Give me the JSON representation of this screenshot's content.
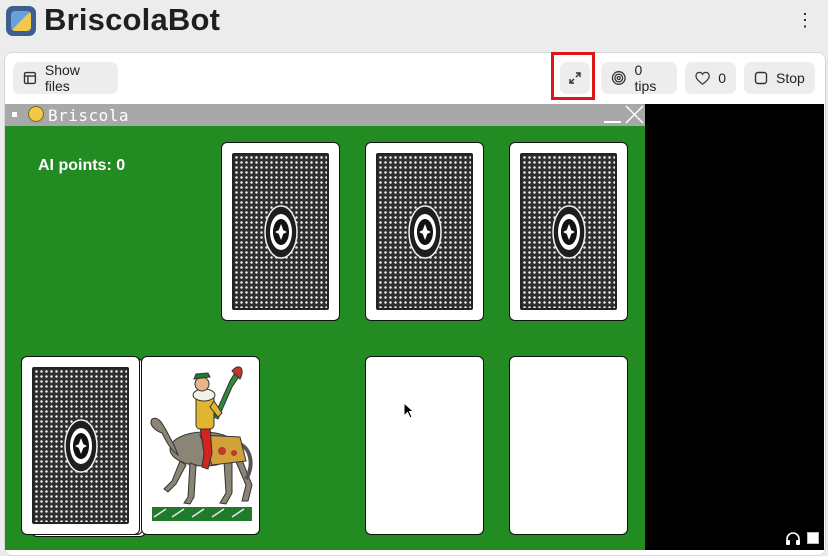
{
  "app": {
    "title": "BriscolaBot",
    "menu_icon": "kebab-menu-icon"
  },
  "toolbar": {
    "show_files_label": "Show files",
    "show_files_icon": "files-icon",
    "expand_icon": "expand-icon",
    "tips_label": "0 tips",
    "tips_icon": "spiral-icon",
    "likes_count": "0",
    "likes_icon": "heart-icon",
    "stop_label": "Stop",
    "stop_icon": "stop-square-icon",
    "highlight_color": "#e0141b"
  },
  "game": {
    "window_title": "Briscola",
    "background_color": "#228b22",
    "ai_points_label": "AI points: 0",
    "opponent_hand": [
      {
        "face": "back"
      },
      {
        "face": "back"
      },
      {
        "face": "back"
      }
    ],
    "deck": {
      "face": "back"
    },
    "briscola_card": {
      "face": "horse-rider",
      "suit_icon": "cavallo-card-illustration"
    },
    "player_slots": [
      {
        "face": "blank"
      },
      {
        "face": "blank"
      }
    ]
  },
  "status_icons": {
    "audio": "headphones-icon",
    "window": "square-icon"
  }
}
